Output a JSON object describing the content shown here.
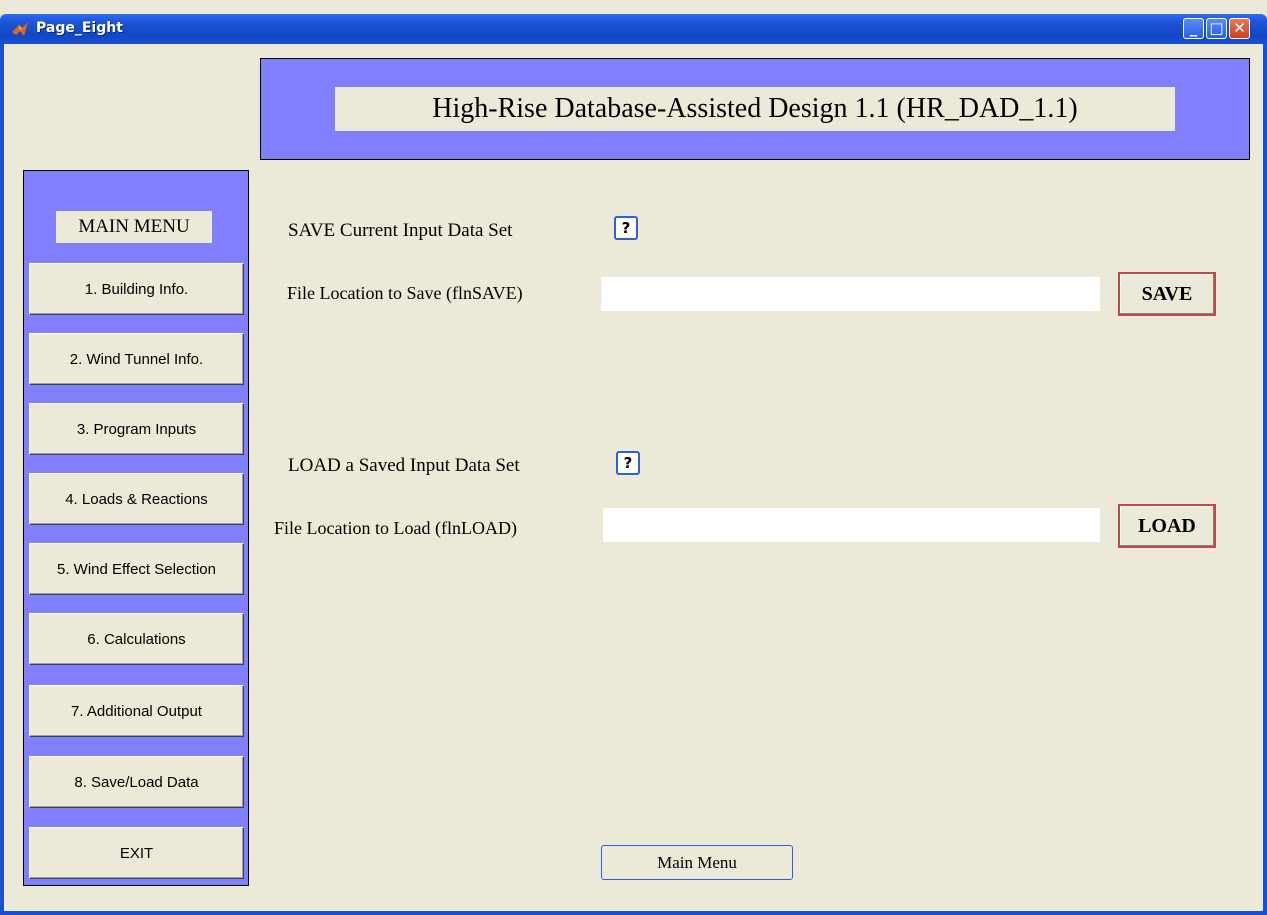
{
  "window": {
    "title": "Page_Eight",
    "controls": {
      "minimize": "_",
      "maximize": "□",
      "close": "✕"
    }
  },
  "header": {
    "title": "High-Rise Database-Assisted Design 1.1 (HR_DAD_1.1)"
  },
  "menu": {
    "heading": "MAIN MENU",
    "items": [
      {
        "label": "1. Building Info."
      },
      {
        "label": "2. Wind Tunnel Info."
      },
      {
        "label": "3. Program Inputs"
      },
      {
        "label": "4. Loads & Reactions"
      },
      {
        "label": "5. Wind Effect Selection"
      },
      {
        "label": "6. Calculations"
      },
      {
        "label": "7.  Additional Output"
      },
      {
        "label": "8. Save/Load Data"
      },
      {
        "label": "EXIT"
      }
    ]
  },
  "save_section": {
    "title": "SAVE Current Input Data Set",
    "help": "?",
    "field_label": "File Location to Save (flnSAVE)",
    "field_value": "",
    "button_label": "SAVE"
  },
  "load_section": {
    "title": "LOAD a Saved Input Data Set",
    "help": "?",
    "field_label": "File Location to Load (flnLOAD)",
    "field_value": "",
    "button_label": "LOAD"
  },
  "footer": {
    "main_menu_label": "Main Menu"
  },
  "colors": {
    "panel_bg": "#8080ff",
    "window_bg": "#ece9d8",
    "titlebar": "#1047c6"
  }
}
